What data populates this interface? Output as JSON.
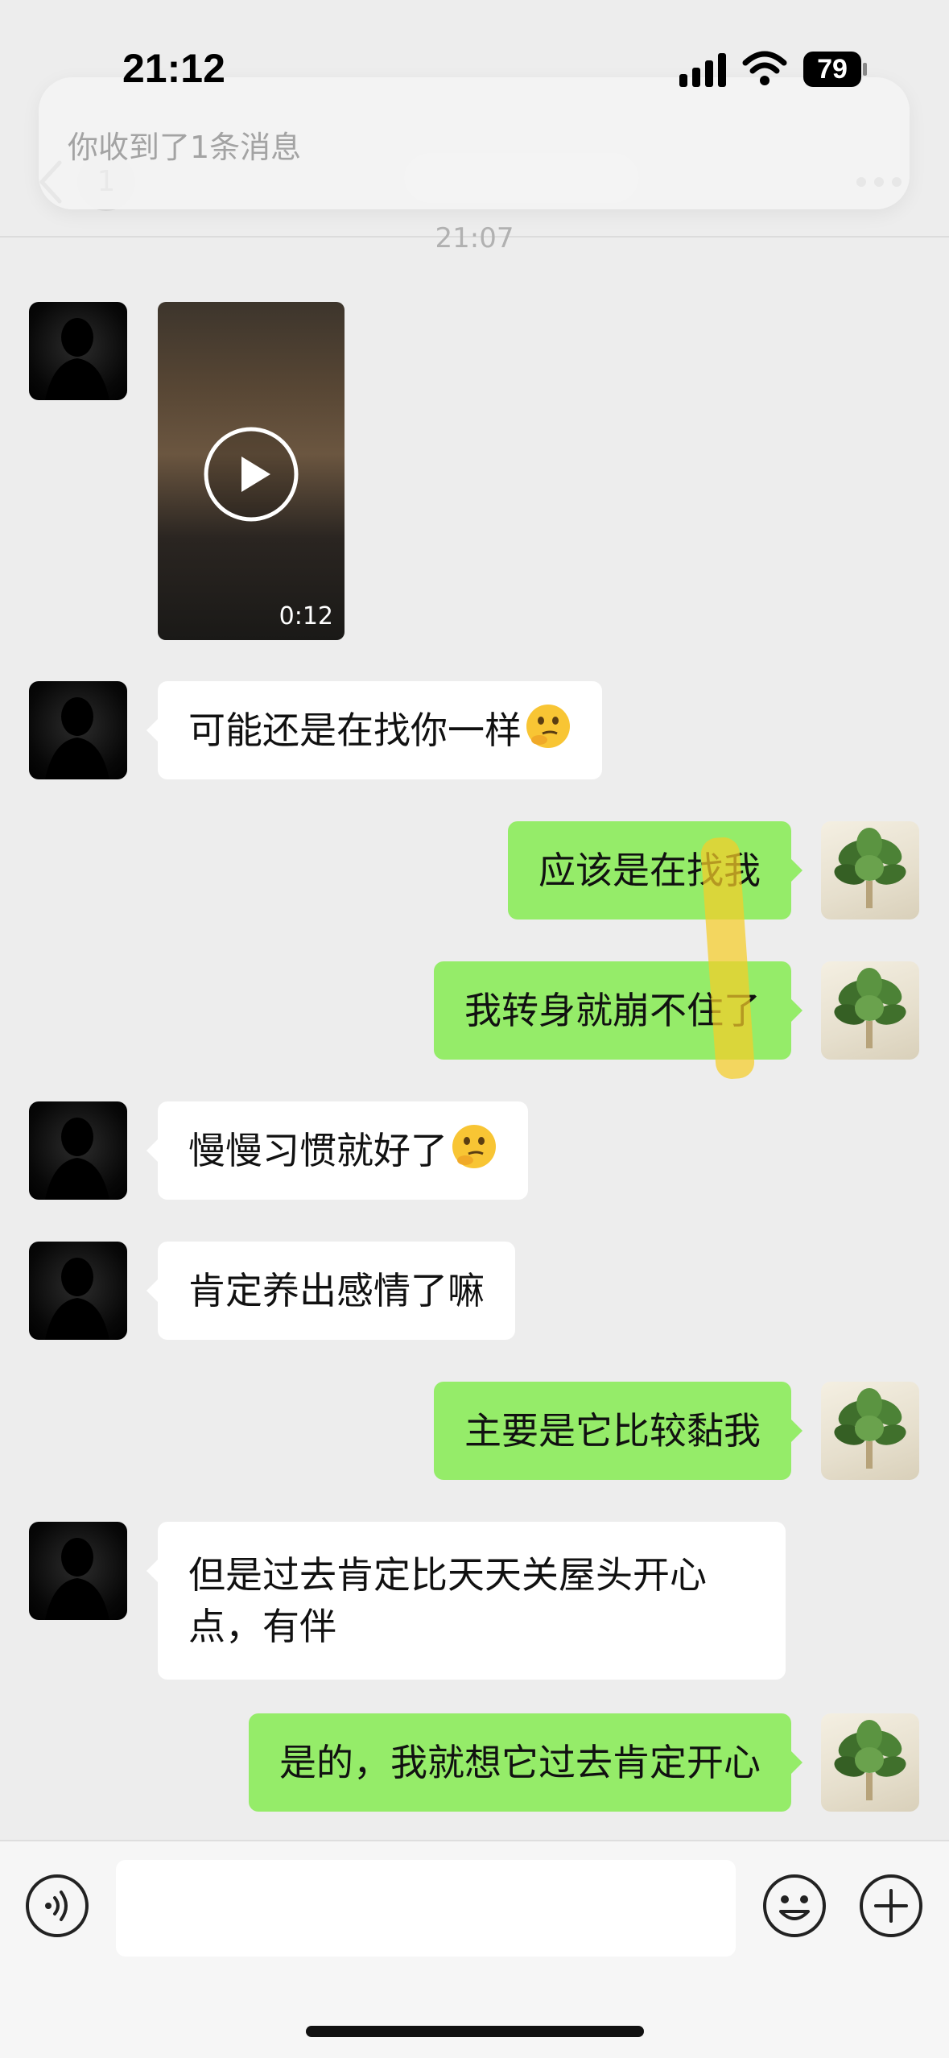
{
  "status_bar": {
    "time": "21:12",
    "battery": "79"
  },
  "notification": {
    "text": "你收到了1条消息"
  },
  "nav": {
    "unread_count": "1"
  },
  "chat": {
    "timestamp": "21:07",
    "video": {
      "duration": "0:12"
    },
    "messages": [
      {
        "side": "left",
        "text": "可能还是在找你一样",
        "emoji": "thinking-face"
      },
      {
        "side": "right",
        "text": "应该是在找我"
      },
      {
        "side": "right",
        "text": "我转身就崩不住了"
      },
      {
        "side": "left",
        "text": "慢慢习惯就好了",
        "emoji": "thinking-face"
      },
      {
        "side": "left",
        "text": "肯定养出感情了嘛"
      },
      {
        "side": "right",
        "text": "主要是它比较黏我"
      },
      {
        "side": "left",
        "text": "但是过去肯定比天天关屋头开心",
        "text2": "点，有伴"
      },
      {
        "side": "right",
        "text": "是的，我就想它过去肯定开心"
      }
    ]
  },
  "colors": {
    "background": "#ededed",
    "sent_bubble": "#95ec69",
    "received_bubble": "#ffffff"
  },
  "input": {
    "value": "",
    "icons": [
      "voice-icon",
      "emoji-icon",
      "plus-icon"
    ]
  }
}
